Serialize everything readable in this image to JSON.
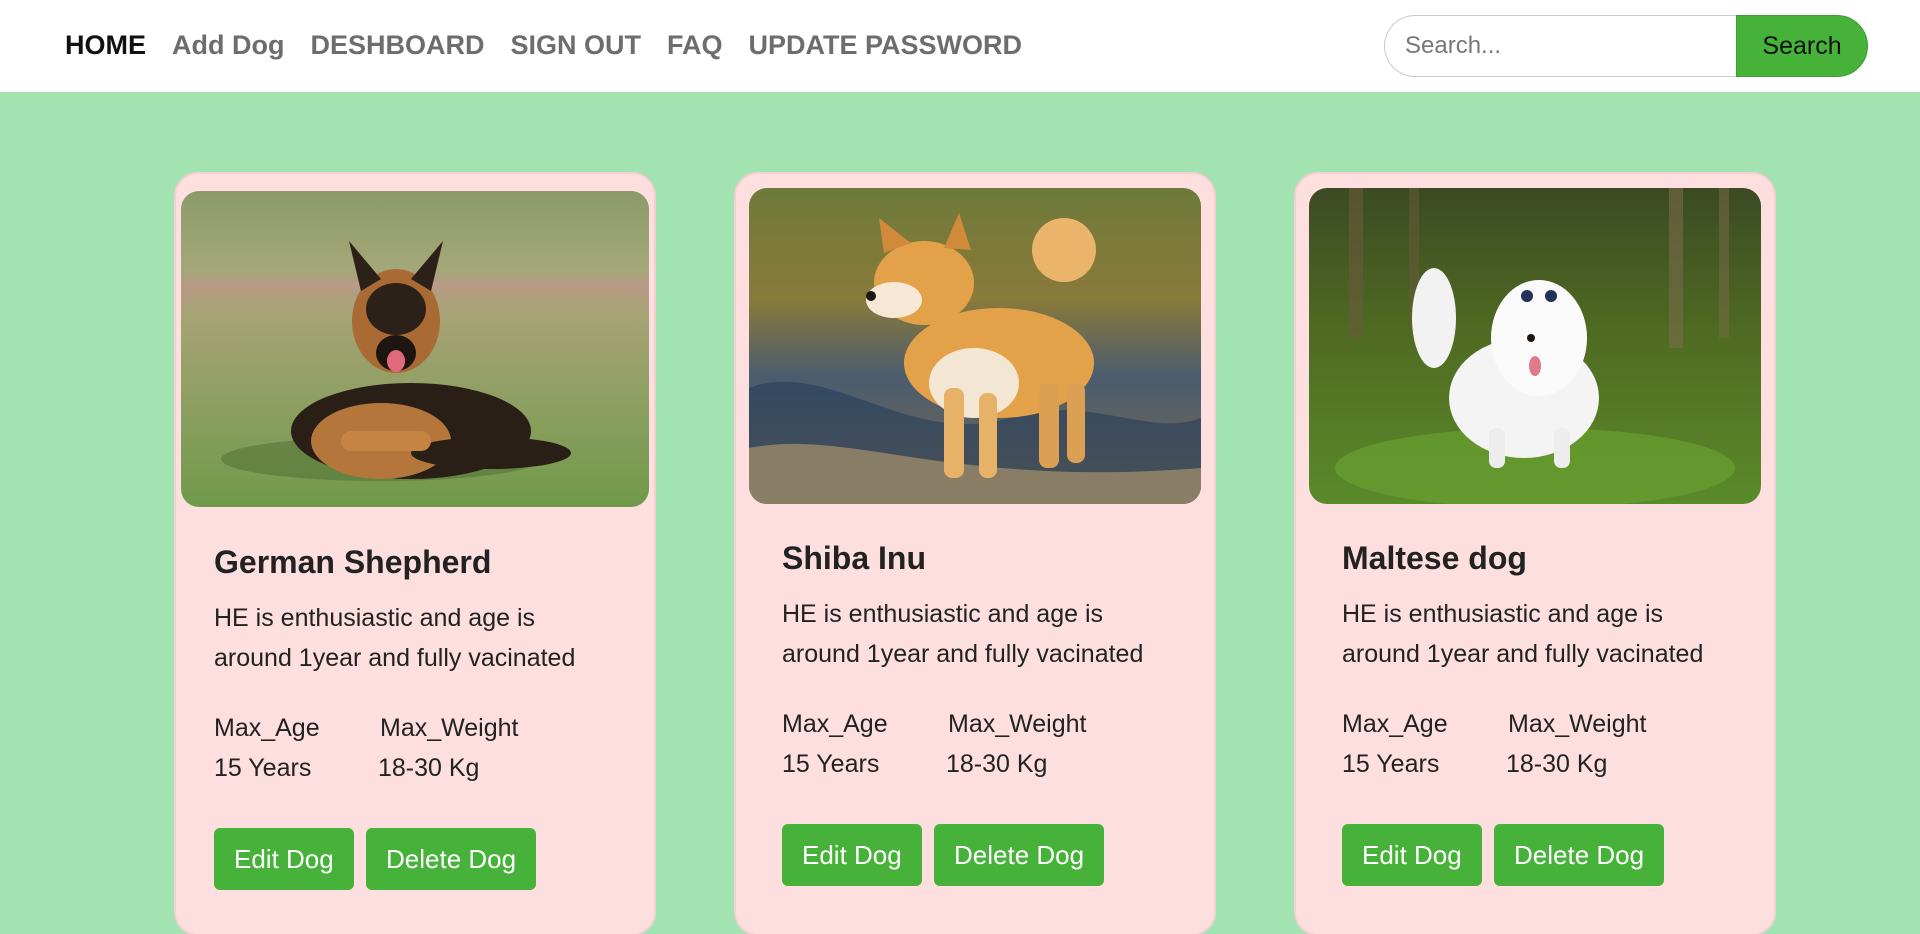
{
  "nav": {
    "items": [
      {
        "label": "HOME",
        "active": true
      },
      {
        "label": "Add Dog",
        "active": false
      },
      {
        "label": "DESHBOARD",
        "active": false
      },
      {
        "label": "SIGN OUT",
        "active": false
      },
      {
        "label": "FAQ",
        "active": false
      },
      {
        "label": "UPDATE PASSWORD",
        "active": false
      }
    ]
  },
  "search": {
    "placeholder": "Search...",
    "value": "",
    "button_label": "Search"
  },
  "colors": {
    "page_bg": "#a3e2b1",
    "card_bg": "#fddfe0",
    "accent": "#46b23a"
  },
  "cards": [
    {
      "title": "German Shepherd",
      "description": "HE is enthusiastic and age is around 1year and fully vacinated",
      "max_age_label": "Max_Age",
      "max_weight_label": "Max_Weight",
      "max_age_value": "15 Years",
      "max_weight_value": "18-30 Kg",
      "edit_label": "Edit Dog",
      "delete_label": "Delete Dog",
      "photo": "german-shepherd-photo"
    },
    {
      "title": "Shiba Inu",
      "description": "HE is enthusiastic and age is around 1year and fully vacinated",
      "max_age_label": "Max_Age",
      "max_weight_label": "Max_Weight",
      "max_age_value": "15 Years",
      "max_weight_value": "18-30 Kg",
      "edit_label": "Edit Dog",
      "delete_label": "Delete Dog",
      "photo": "shiba-inu-photo"
    },
    {
      "title": "Maltese dog",
      "description": "HE is enthusiastic and age is around 1year and fully vacinated",
      "max_age_label": "Max_Age",
      "max_weight_label": "Max_Weight",
      "max_age_value": "15 Years",
      "max_weight_value": "18-30 Kg",
      "edit_label": "Edit Dog",
      "delete_label": "Delete Dog",
      "photo": "maltese-dog-photo"
    }
  ]
}
